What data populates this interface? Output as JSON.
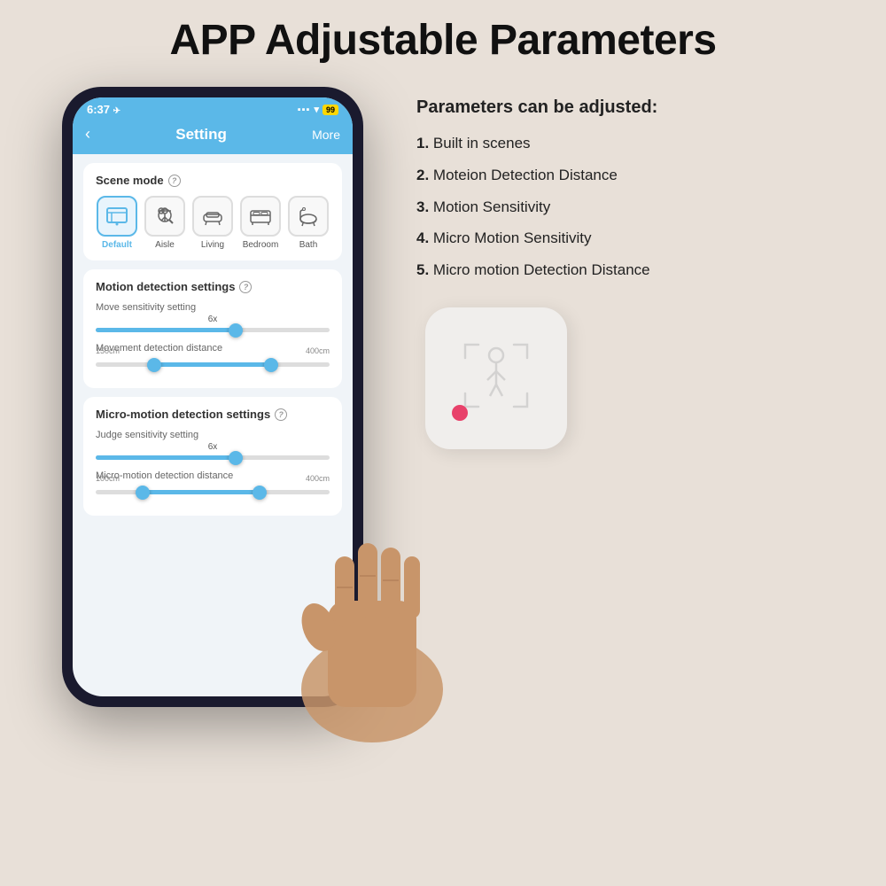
{
  "page": {
    "title": "APP Adjustable Parameters",
    "background_color": "#e8e0d8"
  },
  "phone": {
    "status_bar": {
      "time": "6:37",
      "time_icon": "◀",
      "signal": "▪▪▪",
      "wifi": "WiFi",
      "battery": "99"
    },
    "header": {
      "back": "‹",
      "title": "Setting",
      "more": "More"
    },
    "scene_section": {
      "title": "Scene mode",
      "scenes": [
        {
          "label": "Default",
          "active": true,
          "icon": "🏠"
        },
        {
          "label": "Aisle",
          "active": false,
          "icon": "🚶"
        },
        {
          "label": "Living",
          "active": false,
          "icon": "🛋"
        },
        {
          "label": "Bedroom",
          "active": false,
          "icon": "🛏"
        },
        {
          "label": "Bath",
          "active": false,
          "icon": "🚿"
        }
      ]
    },
    "motion_section": {
      "title": "Motion detection settings",
      "sliders": [
        {
          "label": "Move sensitivity setting",
          "value_label": "6x",
          "fill_percent": 60,
          "thumb_percent": 60
        },
        {
          "label": "Movement detection distance",
          "range_min": "150cm",
          "range_max": "400cm",
          "fill_percent": 40,
          "thumb1_percent": 25,
          "thumb2_percent": 75,
          "dual": true
        }
      ]
    },
    "micro_motion_section": {
      "title": "Micro-motion detection settings",
      "sliders": [
        {
          "label": "Judge sensitivity setting",
          "value_label": "6x",
          "fill_percent": 60,
          "thumb_percent": 60
        },
        {
          "label": "Micro-motion detection distance",
          "range_min": "100cm",
          "range_max": "400cm",
          "fill_percent": 50,
          "thumb1_percent": 20,
          "thumb2_percent": 70,
          "dual": true
        }
      ]
    }
  },
  "right_panel": {
    "intro": "Parameters can be adjusted:",
    "items": [
      {
        "num": "1.",
        "text": "Built in scenes"
      },
      {
        "num": "2.",
        "text": "Moteion Detection Distance"
      },
      {
        "num": "3.",
        "text": "Motion Sensitivity"
      },
      {
        "num": "4.",
        "text": "Micro Motion Sensitivity"
      },
      {
        "num": "5.",
        "text": "Micro motion Detection Distance"
      }
    ]
  },
  "device": {
    "dot_color": "#e8416a"
  },
  "icons": {
    "default_scene": "☰",
    "aisle_scene": "🔍",
    "living_scene": "🛋",
    "bedroom_scene": "🏠",
    "bath_scene": "🚽"
  }
}
